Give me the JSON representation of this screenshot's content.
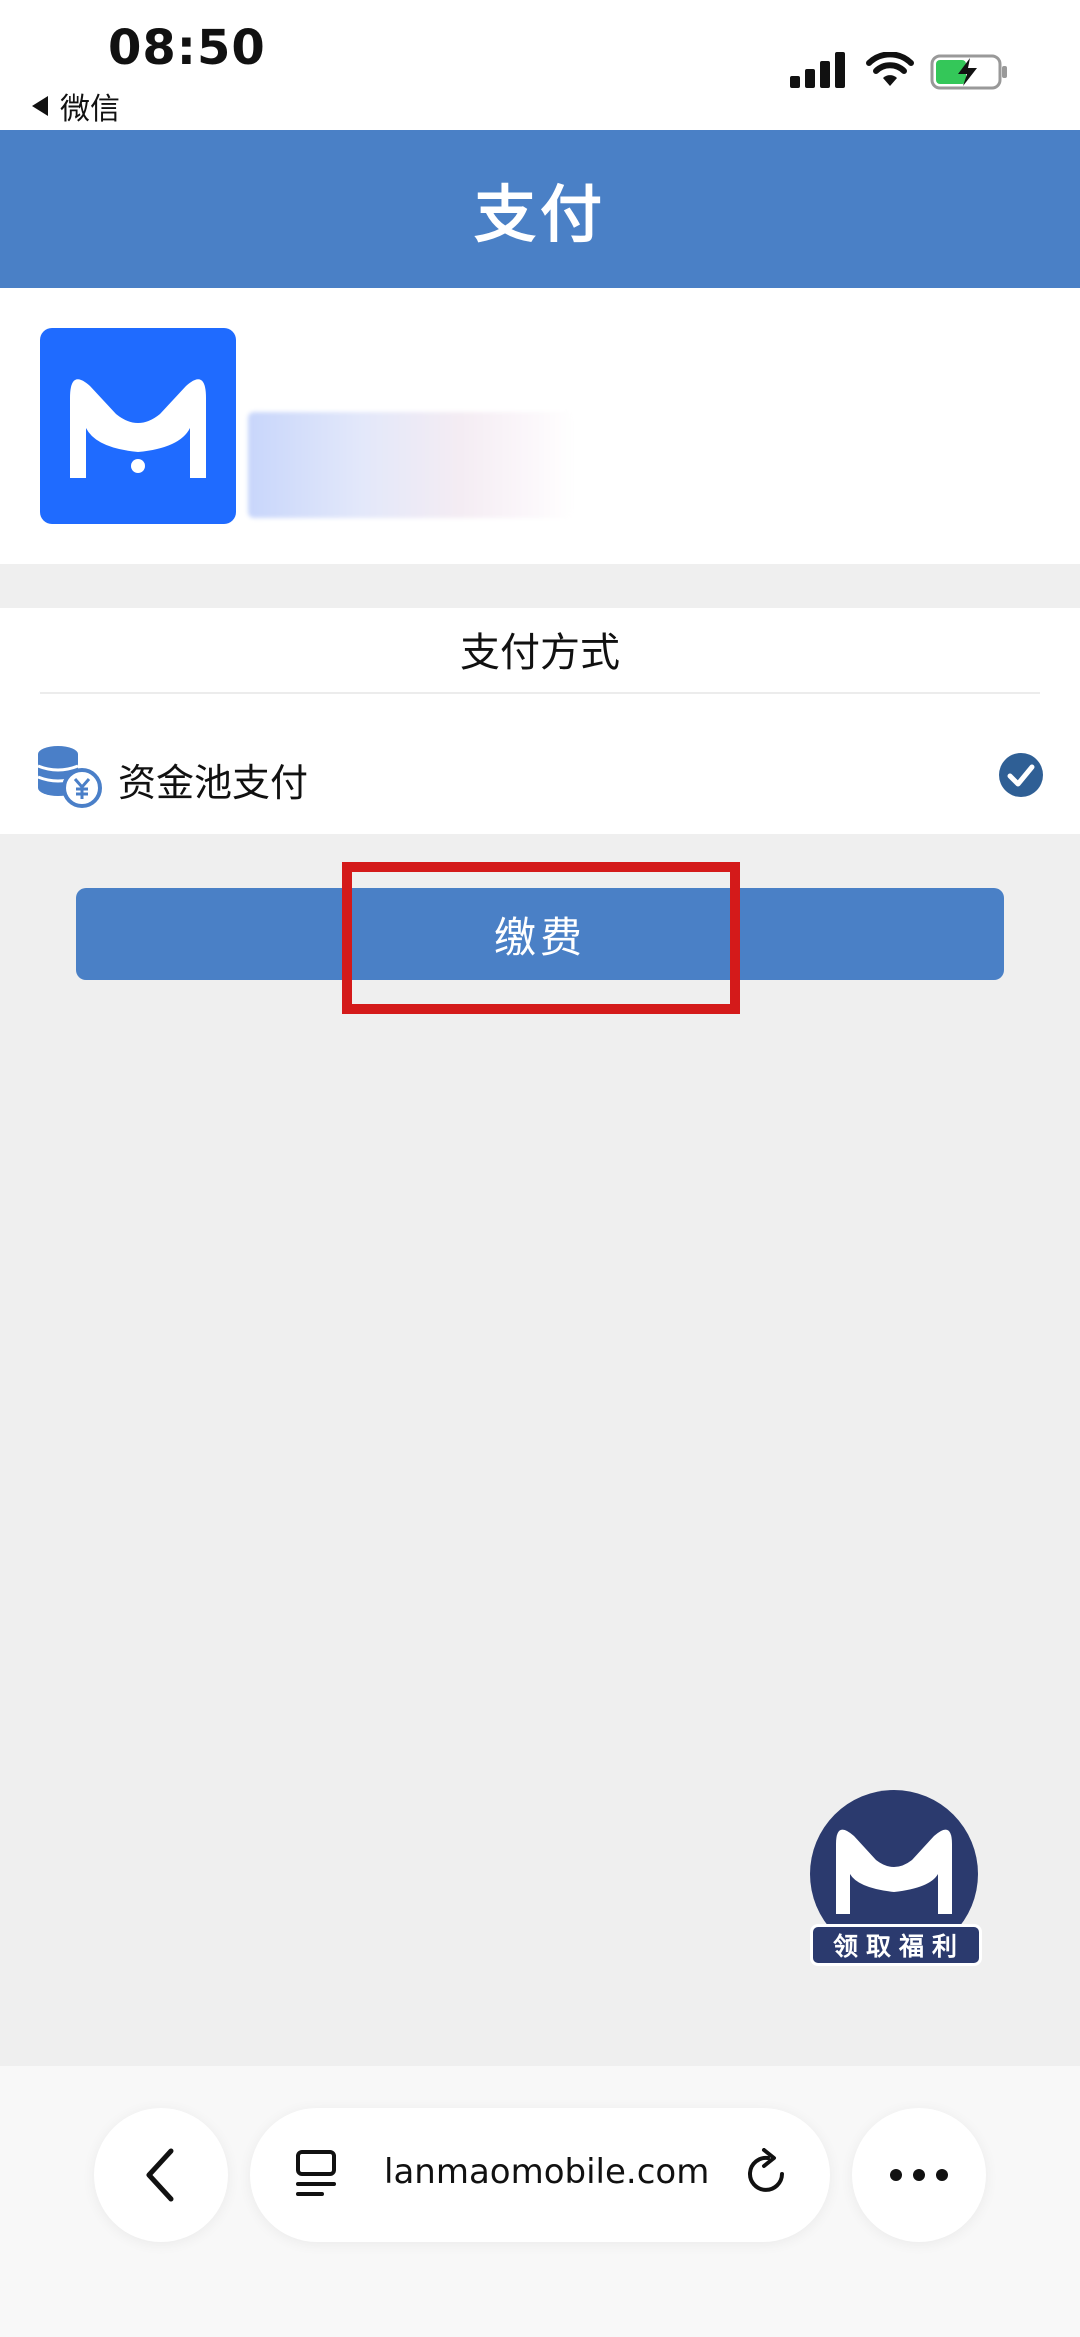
{
  "status_bar": {
    "time": "08:50",
    "back_app": "微信"
  },
  "header": {
    "title": "支付"
  },
  "merchant": {
    "logo_icon": "m-cat-logo-icon",
    "name_blurred": true
  },
  "payment": {
    "section_title": "支付方式",
    "methods": [
      {
        "label": "资金池支付",
        "icon": "coins-yuan-icon",
        "selected": true
      }
    ],
    "pay_button_label": "缴费"
  },
  "badge": {
    "label": "领取福利"
  },
  "browser": {
    "url": "lanmaomobile.com"
  },
  "colors": {
    "header_bg": "#4a80c6",
    "button_bg": "#4a80c6",
    "highlight": "#d41a1a",
    "logo_bg": "#1f6bff",
    "badge_bg": "#2b3a6e"
  }
}
